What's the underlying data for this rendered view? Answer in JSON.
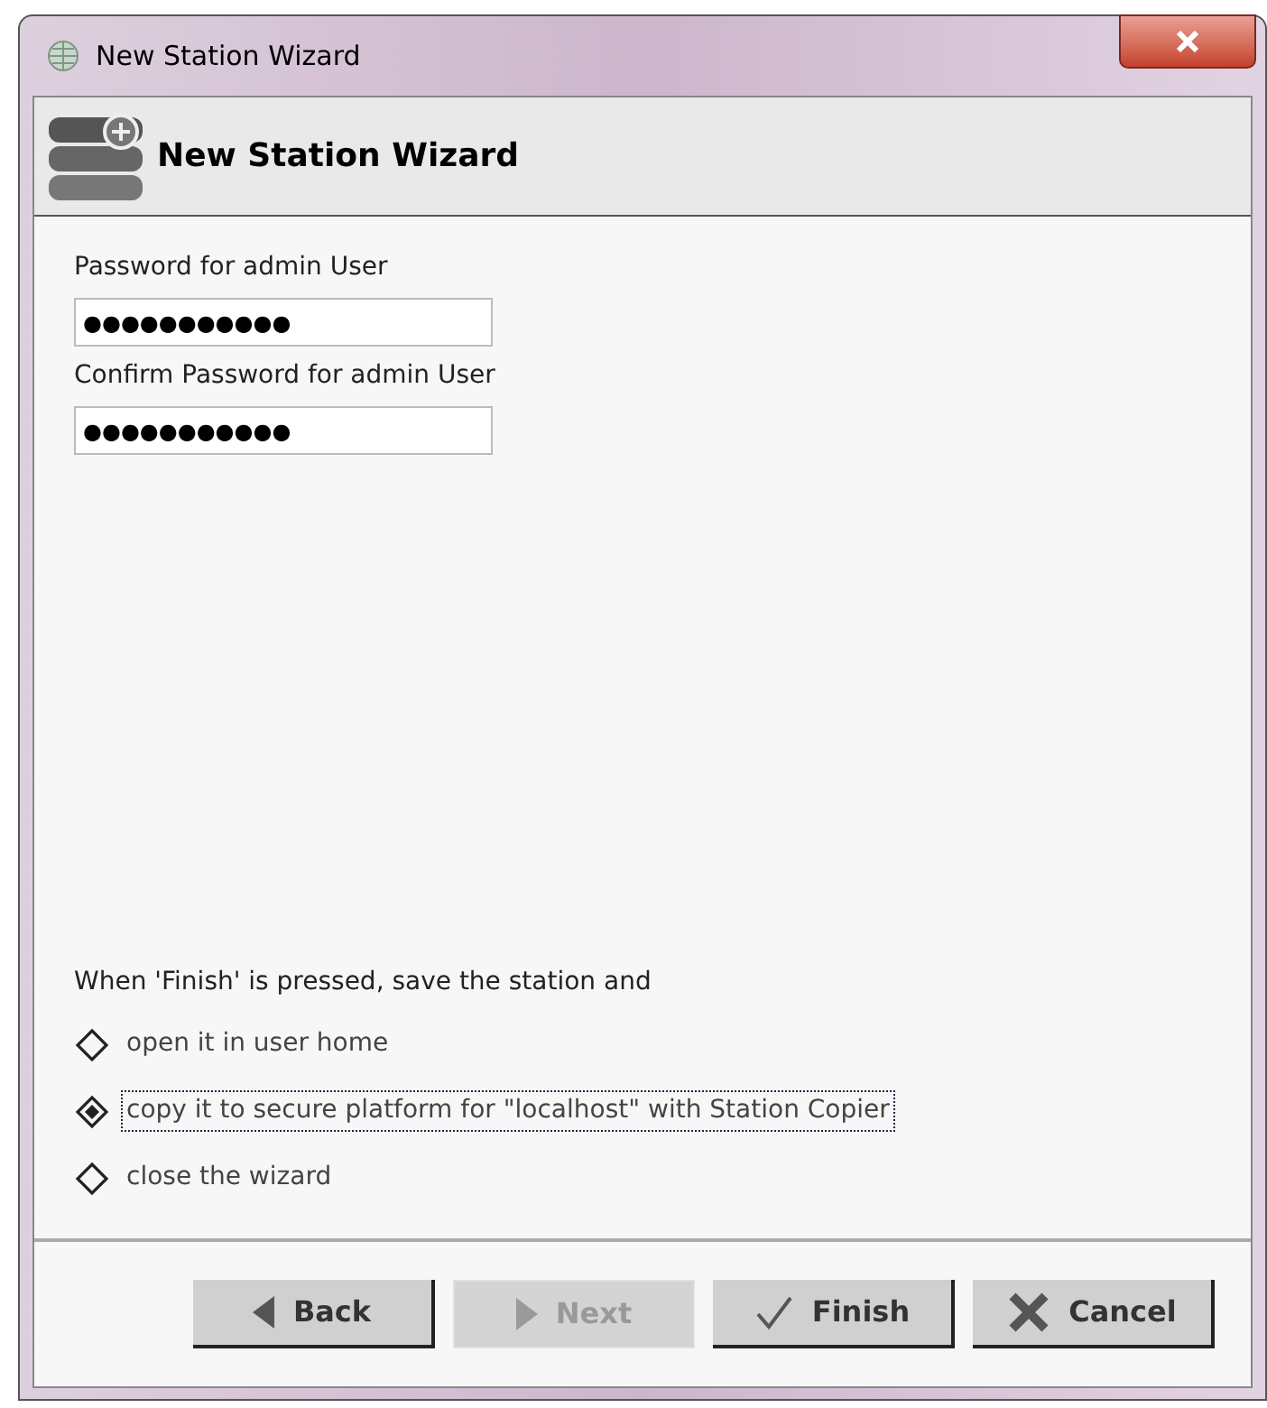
{
  "window": {
    "title": "New Station Wizard"
  },
  "header": {
    "title": "New Station Wizard"
  },
  "fields": [
    {
      "label": "Password for admin User",
      "value": "●●●●●●●●●●●"
    },
    {
      "label": "Confirm Password for admin User",
      "value": "●●●●●●●●●●●"
    }
  ],
  "options": {
    "prompt": "When 'Finish' is pressed, save the station and",
    "items": [
      {
        "label": "open it in user home",
        "selected": false
      },
      {
        "label": "copy it to secure platform for \"localhost\" with Station Copier",
        "selected": true
      },
      {
        "label": "close the wizard",
        "selected": false
      }
    ]
  },
  "buttons": [
    {
      "kind": "back",
      "label": "Back",
      "disabled": false
    },
    {
      "kind": "next",
      "label": "Next",
      "disabled": true
    },
    {
      "kind": "finish",
      "label": "Finish",
      "disabled": false
    },
    {
      "kind": "cancel",
      "label": "Cancel",
      "disabled": false
    }
  ]
}
